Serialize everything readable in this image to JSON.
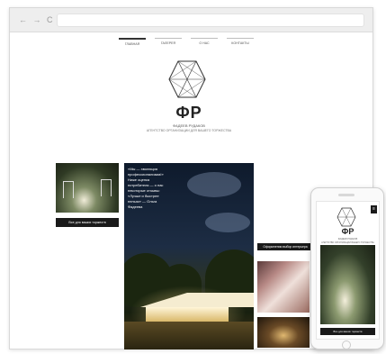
{
  "browser": {
    "nav_buttons": "← → C",
    "url": ""
  },
  "site": {
    "nav": [
      {
        "label": "главная",
        "active": true
      },
      {
        "label": "галерея",
        "active": false
      },
      {
        "label": "о нас",
        "active": false
      },
      {
        "label": "контакты",
        "active": false
      }
    ],
    "brand": "ФР",
    "subtitle": "ФАДЕЕВ РУДАКОВ",
    "tagline": "АГЕНТСТВО ОРГАНИЗАЦИИ ДЛЯ ВАШЕГО ТОРЖЕСТВА"
  },
  "content": {
    "thumb1_button": "Все для ваших торжеств",
    "quote": "«Мы — эволюция профессионализма!» Ниже оценка потребителя — о нас некоторые отзывы: «Лучше и быстрее нельзя» — Ольга Фадеева",
    "label2": "Оформлении выбор интерьера",
    "accent": "#1a1a1a"
  },
  "phone": {
    "menu_icon": "≡",
    "brand": "ФР",
    "subtitle": "ФАДЕЕВ РУДАКОВ",
    "tagline": "АГЕНТСТВО ОРГАНИЗАЦИИ ВАШЕГО ТОРЖЕСТВА",
    "button": "Все для ваших торжеств"
  }
}
